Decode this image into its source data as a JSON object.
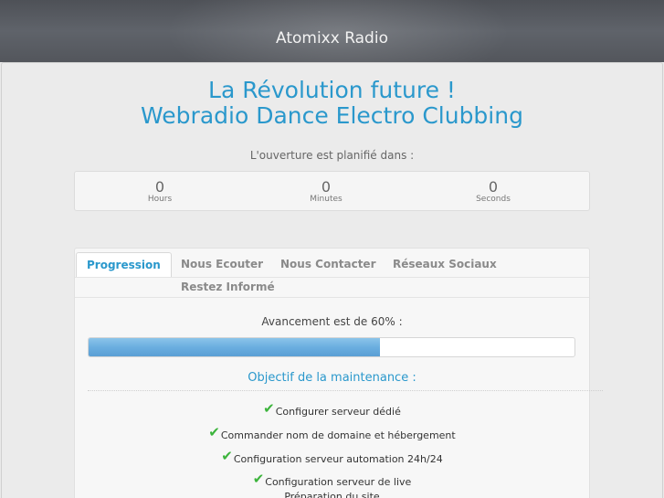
{
  "header": {
    "site_title": "Atomixx Radio"
  },
  "hero": {
    "line1": "La Révolution future !",
    "line2": "Webradio Dance Electro Clubbing"
  },
  "countdown": {
    "label": "L'ouverture est planifié dans :",
    "hours": {
      "value": "0",
      "unit": "Hours"
    },
    "minutes": {
      "value": "0",
      "unit": "Minutes"
    },
    "seconds": {
      "value": "0",
      "unit": "Seconds"
    }
  },
  "tabs": [
    {
      "label": "Progression",
      "active": true
    },
    {
      "label": "Nous Ecouter",
      "active": false
    },
    {
      "label": "Nous Contacter",
      "active": false
    },
    {
      "label": "Réseaux Sociaux",
      "active": false
    },
    {
      "label": "Restez Informé",
      "active": false
    }
  ],
  "progress": {
    "label": "Avancement est de 60% :",
    "percent": 60
  },
  "objectives": {
    "title": "Objectif de la maintenance :",
    "tasks": [
      {
        "label": "Configurer serveur dédié",
        "done": true
      },
      {
        "label": "Commander nom de domaine et hébergement",
        "done": true
      },
      {
        "label": "Configuration serveur automation 24h/24",
        "done": true
      },
      {
        "label": "Configuration serveur de live",
        "done": true
      },
      {
        "label": "Préparation du site",
        "done": false
      }
    ]
  },
  "colors": {
    "accent": "#2a98cc",
    "check": "#3cb43c",
    "progress_fill": "#6aaee0"
  },
  "icons": {
    "task_done": "check-icon"
  }
}
